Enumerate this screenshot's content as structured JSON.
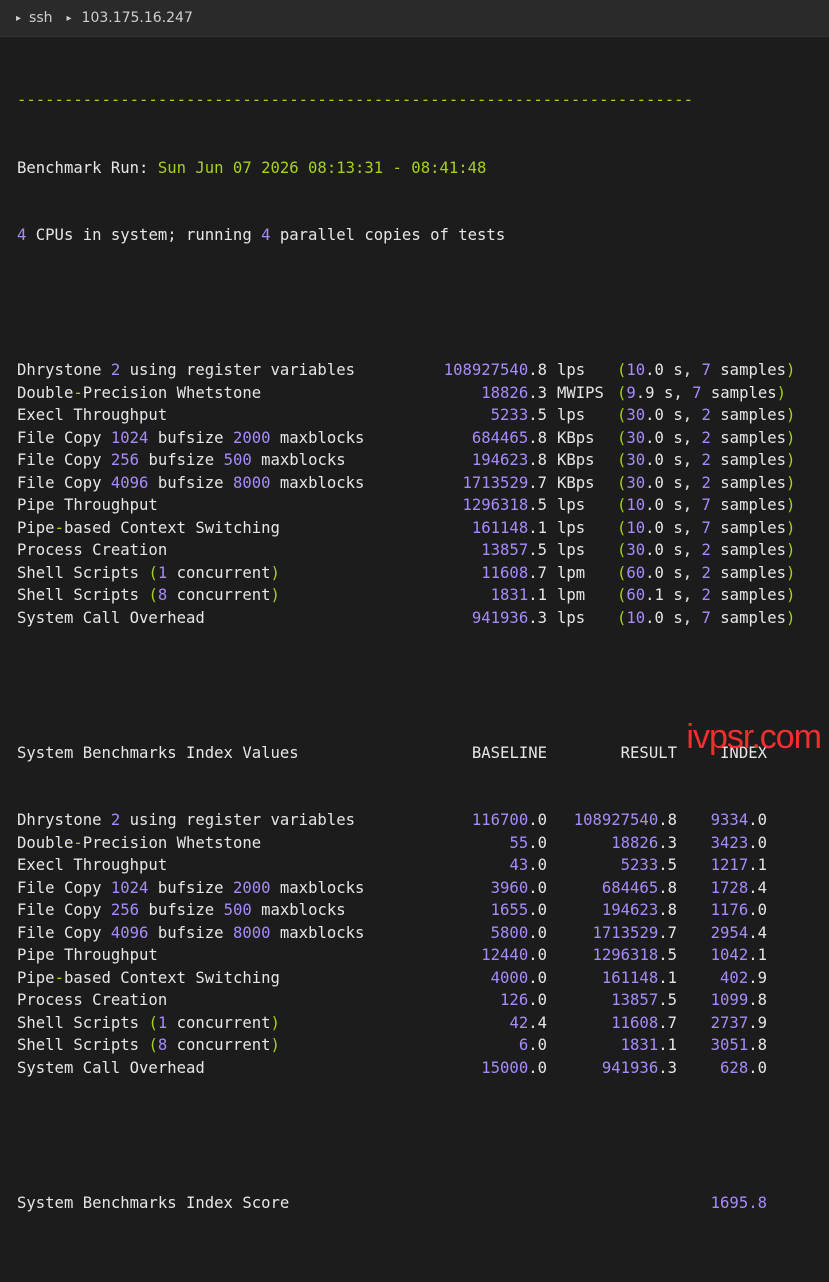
{
  "titlebar": {
    "app": "ssh",
    "host": "103.175.16.247"
  },
  "terminal": {
    "dashes": "------------------------------------------------------------------------",
    "run_label": "Benchmark Run:",
    "run_time": "Sun Jun 07 2026 08:13:31 - 08:41:48",
    "cpus_line_pre": "4",
    "cpus_line_mid": " CPUs in system; running ",
    "cpus_line_num": "4",
    "cpus_line_post": " parallel copies of tests",
    "results": [
      {
        "name": "Dhrystone 2 using register variables",
        "value": "108927540.8",
        "unit": "lps",
        "time": "10.0",
        "samples": "7"
      },
      {
        "name": "Double-Precision Whetstone",
        "value": "18826.3",
        "unit": "MWIPS",
        "time": "9.9",
        "samples": "7"
      },
      {
        "name": "Execl Throughput",
        "value": "5233.5",
        "unit": "lps",
        "time": "30.0",
        "samples": "2"
      },
      {
        "name": "File Copy 1024 bufsize 2000 maxblocks",
        "value": "684465.8",
        "unit": "KBps",
        "time": "30.0",
        "samples": "2"
      },
      {
        "name": "File Copy 256 bufsize 500 maxblocks",
        "value": "194623.8",
        "unit": "KBps",
        "time": "30.0",
        "samples": "2"
      },
      {
        "name": "File Copy 4096 bufsize 8000 maxblocks",
        "value": "1713529.7",
        "unit": "KBps",
        "time": "30.0",
        "samples": "2"
      },
      {
        "name": "Pipe Throughput",
        "value": "1296318.5",
        "unit": "lps",
        "time": "10.0",
        "samples": "7"
      },
      {
        "name": "Pipe-based Context Switching",
        "value": "161148.1",
        "unit": "lps",
        "time": "10.0",
        "samples": "7"
      },
      {
        "name": "Process Creation",
        "value": "13857.5",
        "unit": "lps",
        "time": "30.0",
        "samples": "2"
      },
      {
        "name": "Shell Scripts (1 concurrent)",
        "value": "11608.7",
        "unit": "lpm",
        "time": "60.0",
        "samples": "2"
      },
      {
        "name": "Shell Scripts (8 concurrent)",
        "value": "1831.1",
        "unit": "lpm",
        "time": "60.1",
        "samples": "2"
      },
      {
        "name": "System Call Overhead",
        "value": "941936.3",
        "unit": "lps",
        "time": "10.0",
        "samples": "7"
      }
    ],
    "index_header": {
      "title": "System Benchmarks Index Values",
      "baseline": "BASELINE",
      "result": "RESULT",
      "index": "INDEX"
    },
    "index_rows": [
      {
        "name": "Dhrystone 2 using register variables",
        "baseline": "116700.0",
        "result": "108927540.8",
        "index": "9334.0"
      },
      {
        "name": "Double-Precision Whetstone",
        "baseline": "55.0",
        "result": "18826.3",
        "index": "3423.0"
      },
      {
        "name": "Execl Throughput",
        "baseline": "43.0",
        "result": "5233.5",
        "index": "1217.1"
      },
      {
        "name": "File Copy 1024 bufsize 2000 maxblocks",
        "baseline": "3960.0",
        "result": "684465.8",
        "index": "1728.4"
      },
      {
        "name": "File Copy 256 bufsize 500 maxblocks",
        "baseline": "1655.0",
        "result": "194623.8",
        "index": "1176.0"
      },
      {
        "name": "File Copy 4096 bufsize 8000 maxblocks",
        "baseline": "5800.0",
        "result": "1713529.7",
        "index": "2954.4"
      },
      {
        "name": "Pipe Throughput",
        "baseline": "12440.0",
        "result": "1296318.5",
        "index": "1042.1"
      },
      {
        "name": "Pipe-based Context Switching",
        "baseline": "4000.0",
        "result": "161148.1",
        "index": "402.9"
      },
      {
        "name": "Process Creation",
        "baseline": "126.0",
        "result": "13857.5",
        "index": "1099.8"
      },
      {
        "name": "Shell Scripts (1 concurrent)",
        "baseline": "42.4",
        "result": "11608.7",
        "index": "2737.9"
      },
      {
        "name": "Shell Scripts (8 concurrent)",
        "baseline": "6.0",
        "result": "1831.1",
        "index": "3051.8"
      },
      {
        "name": "System Call Overhead",
        "baseline": "15000.0",
        "result": "941936.3",
        "index": "628.0"
      }
    ],
    "score_label": "System Benchmarks Index Score",
    "score_value": "1695.8"
  },
  "watermark": "ivpsr.com",
  "colors": {
    "background": "#1c1c1c",
    "green": "#a6d11d",
    "purple": "#a78bfa",
    "watermark": "#ff2f2f"
  }
}
